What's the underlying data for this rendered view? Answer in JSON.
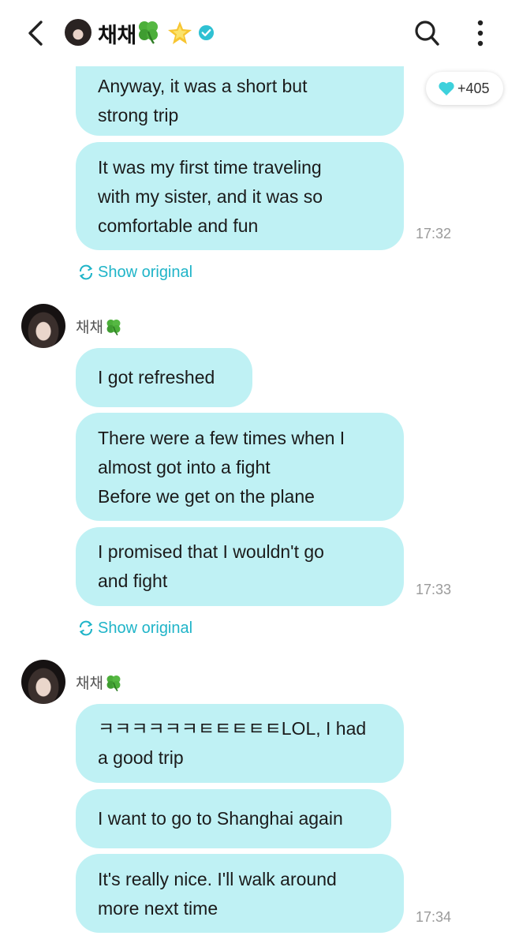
{
  "header": {
    "name": "채채",
    "clover_icon": "four-leaf-clover-icon",
    "star_icon": "glowing-star-icon",
    "verified_icon": "verified-badge-icon",
    "accent": "#1fb4c8"
  },
  "reaction": {
    "icon": "heart-icon",
    "count": "+405"
  },
  "groups": [
    {
      "bubbles": [
        [
          "Anyway, it was a short but",
          "strong trip"
        ],
        [
          "It was my first time traveling",
          "with my sister, and it was so",
          "comfortable and fun"
        ]
      ],
      "time": "17:32",
      "show_original": "Show original"
    },
    {
      "sender": "채채",
      "bubbles": [
        [
          "I got refreshed"
        ],
        [
          "There were a few times when I",
          "almost got into a fight",
          "Before we get on the plane"
        ],
        [
          "I promised that I wouldn't go",
          "and fight"
        ]
      ],
      "time": "17:33",
      "show_original": "Show original"
    },
    {
      "sender": "채채",
      "bubbles": [
        [
          "ㅋㅋㅋㅋㅋㅋㅌㅌㅌㅌㅌLOL, I had",
          "a good trip"
        ],
        [
          "I want to go to Shanghai again"
        ],
        [
          "It's really nice. I'll walk around",
          "more next time"
        ]
      ],
      "time": "17:34"
    }
  ],
  "colors": {
    "bubble": "#bff1f4",
    "time": "#9a9a9a",
    "link": "#1fb4c8"
  }
}
